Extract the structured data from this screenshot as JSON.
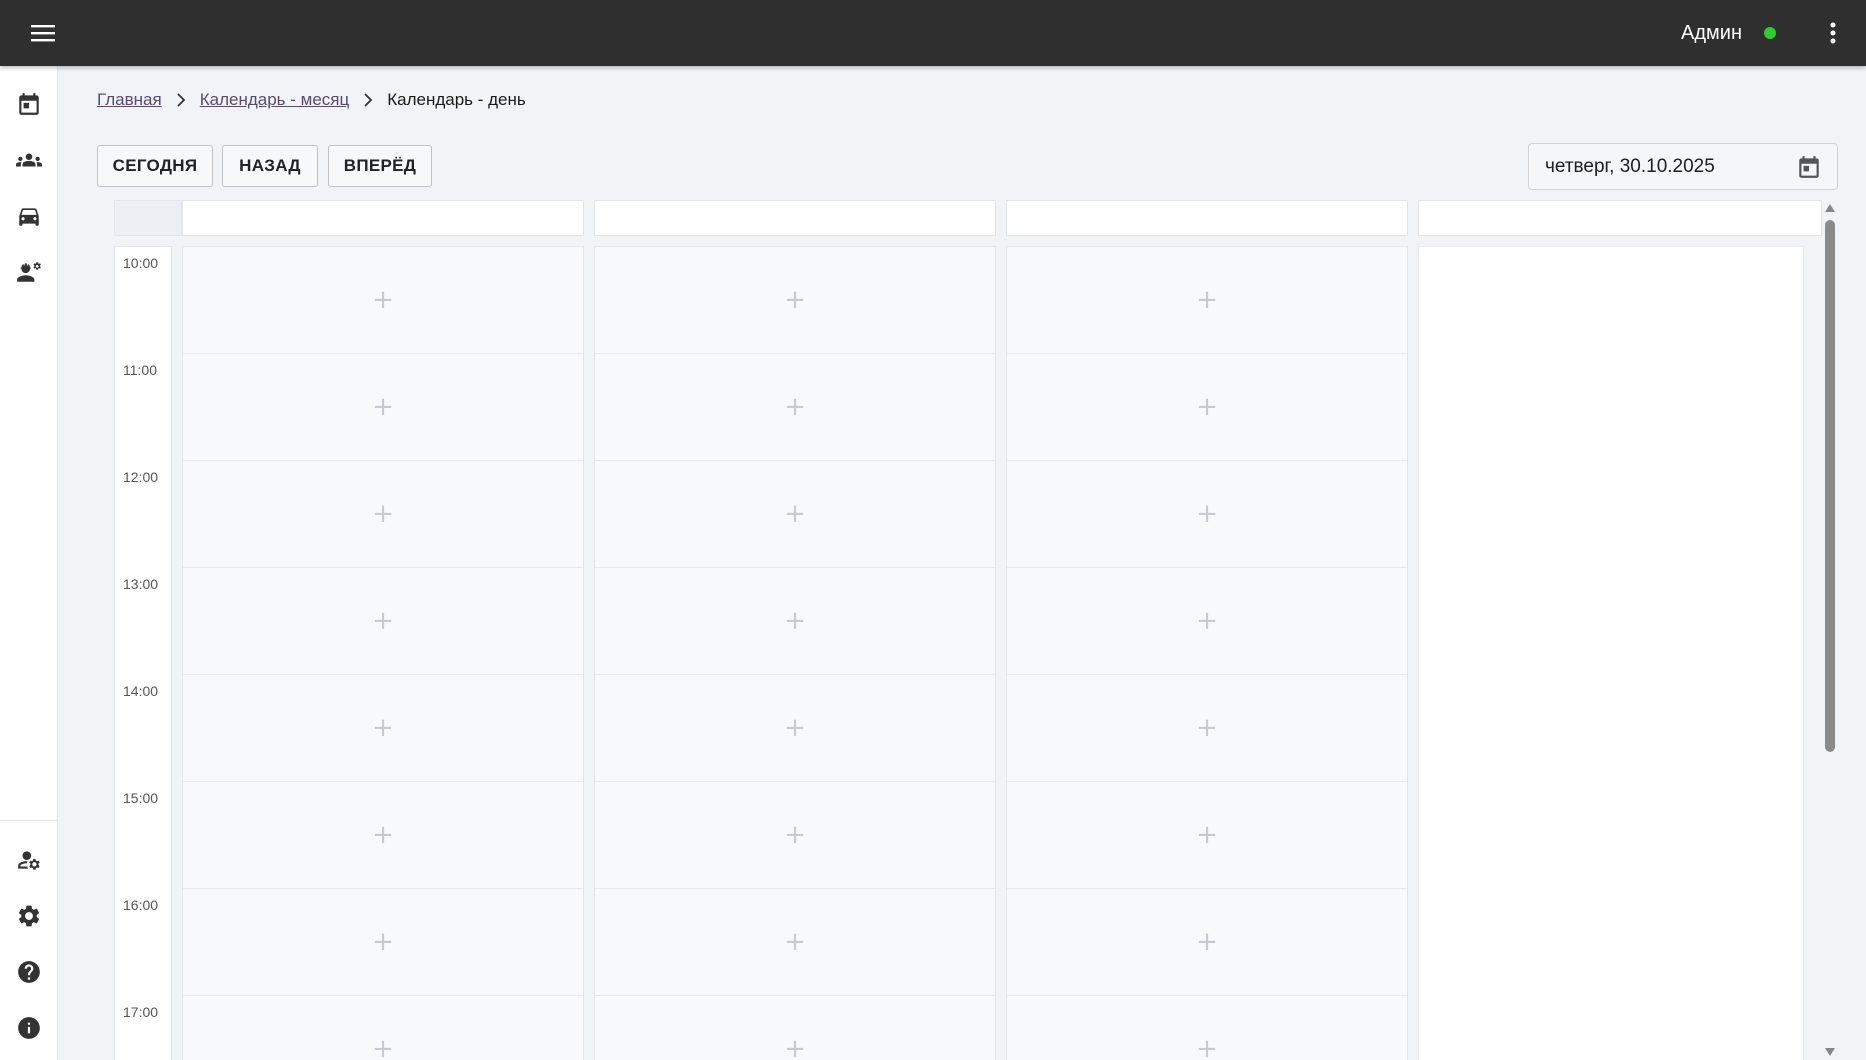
{
  "header": {
    "user_name": "Админ",
    "status_color": "#2ecc2e",
    "menu_icon": "hamburger-menu-icon",
    "more_icon": "more-vertical-icon"
  },
  "sidebar": {
    "top_items": [
      {
        "icon": "calendar-icon"
      },
      {
        "icon": "group-icon"
      },
      {
        "icon": "car-icon"
      },
      {
        "icon": "worker-settings-icon"
      }
    ],
    "bottom_items": [
      {
        "icon": "user-settings-icon"
      },
      {
        "icon": "gear-icon"
      },
      {
        "icon": "help-icon"
      },
      {
        "icon": "info-icon"
      }
    ]
  },
  "breadcrumb": {
    "home": "Главная",
    "month": "Календарь - месяц",
    "current": "Календарь - день"
  },
  "toolbar": {
    "today": "СЕГОДНЯ",
    "back": "НАЗАД",
    "forward": "ВПЕРЁД"
  },
  "date_field": {
    "value": "четверг, 30.10.2025",
    "icon": "calendar-icon"
  },
  "calendar": {
    "times": [
      "10:00",
      "11:00",
      "12:00",
      "13:00",
      "14:00",
      "15:00",
      "16:00",
      "17:00"
    ],
    "add_symbol": "+"
  }
}
